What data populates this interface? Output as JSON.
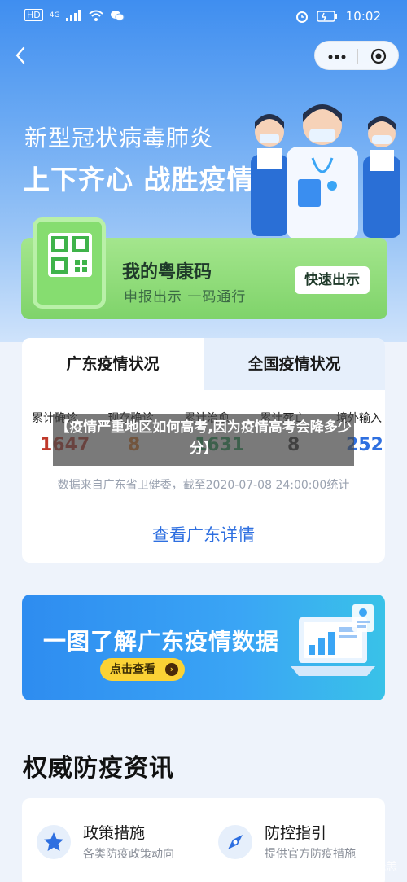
{
  "status_bar": {
    "network": "HD",
    "signal": "4G",
    "time": "10:02"
  },
  "hero": {
    "title_line1": "新型冠状病毒肺炎",
    "title_line2": "上下齐心 战胜疫情"
  },
  "health_code": {
    "title": "我的粤康码",
    "subtitle": "申报出示 一码通行",
    "button_label": "快速出示"
  },
  "stats": {
    "tabs": [
      "广东疫情状况",
      "全国疫情状况"
    ],
    "labels": [
      "累计确诊",
      "现存确诊",
      "累计治愈",
      "累计死亡",
      "境外输入"
    ],
    "values": [
      "1647",
      "8",
      "1631",
      "8",
      "252"
    ],
    "value_colors": [
      "#c0392b",
      "#e07a2a",
      "#27a05a",
      "#333333",
      "#2e6fe0"
    ],
    "note": "数据来自广东省卫健委，截至2020-07-08 24:00:00统计",
    "detail_link": "查看广东详情"
  },
  "overlay": {
    "text": "【疫情严重地区如何高考,因为疫情高考会降多少分】"
  },
  "banner": {
    "title": "一图了解广东疫情数据",
    "button_label": "点击查看"
  },
  "section": {
    "title": "权威防疫资讯"
  },
  "info_items": [
    {
      "title": "政策措施",
      "subtitle": "各类防疫政策动向",
      "icon": "star-icon"
    },
    {
      "title": "防控指引",
      "subtitle": "提供官方防疫措施",
      "icon": "compass-icon"
    }
  ],
  "watermark": "知乎 @郑无恙"
}
